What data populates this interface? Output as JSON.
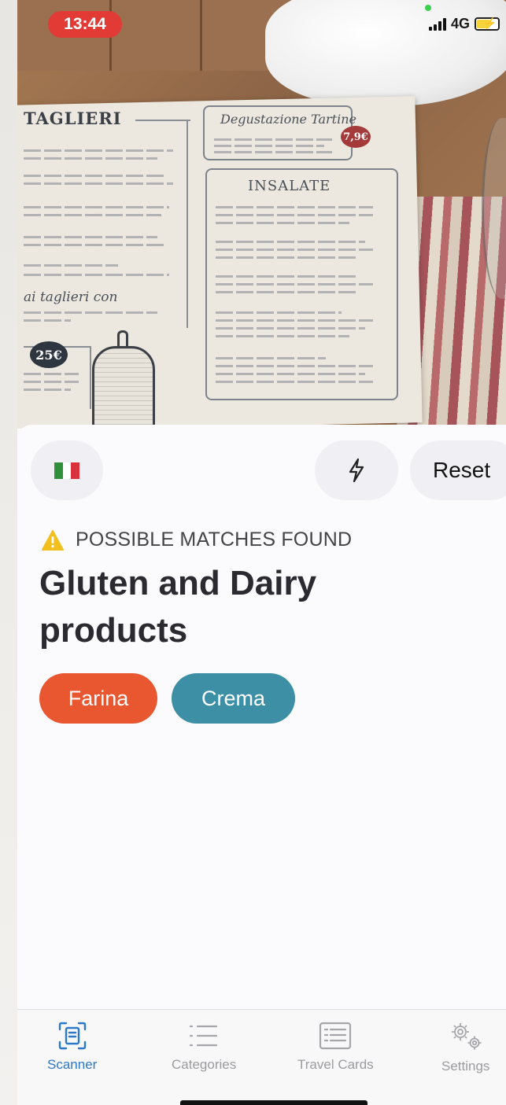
{
  "status_bar": {
    "time": "13:44",
    "network": "4G"
  },
  "camera": {
    "menu_heading": "TAGLIERI",
    "box1_title": "Degustazione Tartine",
    "box1_price": "7,9€",
    "box2_title": "INSALATE",
    "script_line": "ai taglieri con",
    "price_badge": "25€"
  },
  "controls": {
    "language_icon": "italian-flag",
    "flash_icon": "lightning-bolt",
    "reset_label": "Reset"
  },
  "result": {
    "status_icon": "warning-triangle",
    "status_color": "#f2c01e",
    "status_label": "POSSIBLE MATCHES FOUND",
    "title": "Gluten and Dairy products",
    "matches": [
      {
        "label": "Farina",
        "color": "#e8572f"
      },
      {
        "label": "Crema",
        "color": "#3d8fa5"
      }
    ]
  },
  "tabs": [
    {
      "label": "Scanner",
      "icon": "scanner-icon",
      "active": true
    },
    {
      "label": "Categories",
      "icon": "list-icon",
      "active": false
    },
    {
      "label": "Travel Cards",
      "icon": "card-icon",
      "active": false
    },
    {
      "label": "Settings",
      "icon": "gears-icon",
      "active": false
    }
  ],
  "colors": {
    "accent": "#2c78c9",
    "inactive": "#9b9ba0"
  }
}
